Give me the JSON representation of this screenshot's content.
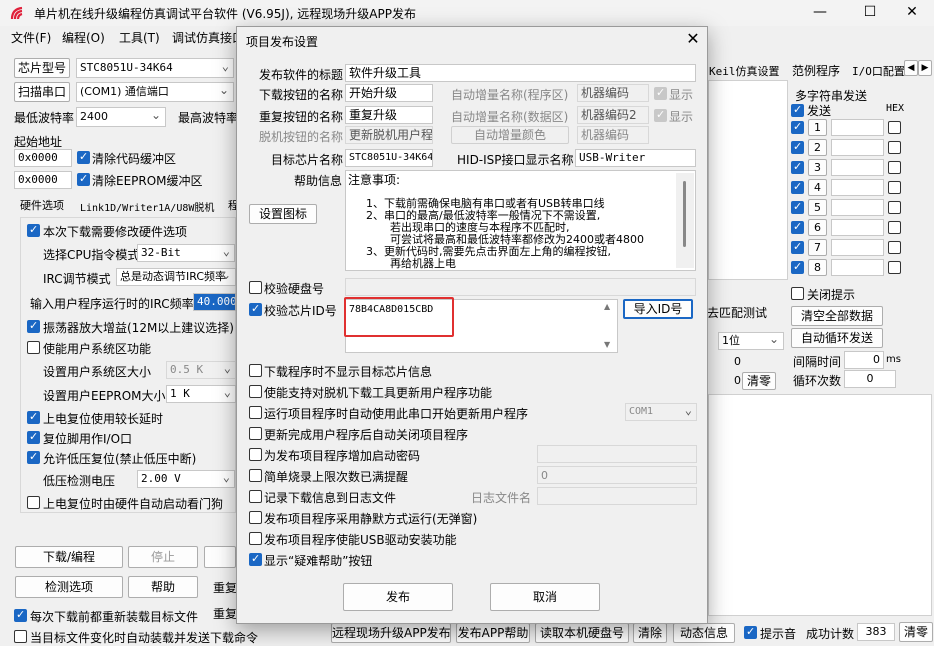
{
  "window": {
    "title": "单片机在线升级编程仿真调试平台软件 (V6.95J), 远程现场升级APP发布",
    "minimize": "—",
    "maximize": "☐",
    "close": "✕"
  },
  "menu": [
    "文件(F)",
    "编程(O)",
    "工具(T)",
    "调试仿真接口"
  ],
  "left": {
    "chip_type_label": "芯片型号",
    "chip_type_value": "STC8051U-34K64",
    "scan_port_button": "扫描串口",
    "port_value": "(COM1) 通信端口",
    "min_baud_label": "最低波特率",
    "min_baud_value": "2400",
    "max_baud_label": "最高波特率",
    "start_addr_label": "起始地址",
    "addr1": "0x0000",
    "clear_code_buffer": "清除代码缓冲区",
    "addr2": "0x0000",
    "clear_eeprom_buffer": "清除EEPROM缓冲区",
    "tabs": [
      "硬件选项",
      "Link1D/Writer1A/U8W脱机",
      "程"
    ],
    "options": {
      "modify_hw": "本次下载需要修改硬件选项",
      "cpu_mode_label": "选择CPU指令模式",
      "cpu_mode_value": "32-Bit",
      "irc_mode_label": "IRC调节模式",
      "irc_mode_value": "总是动态调节IRC频率",
      "irc_freq_label": "输入用户程序运行时的IRC频率",
      "irc_freq_value": "40.000",
      "osc_gain": "振荡器放大增益(12M以上建议选择)",
      "use_user_sys": "使能用户系统区功能",
      "user_sys_size_label": "设置用户系统区大小",
      "user_sys_size_value": "0.5 K",
      "eeprom_size_label": "设置用户EEPROM大小",
      "eeprom_size_value": "1   K",
      "power_reset_delay": "上电复位使用较长延时",
      "reset_pin_io": "复位脚用作I/O口",
      "low_volt_reset": "允许低压复位(禁止低压中断)",
      "low_volt_label": "低压检测电压",
      "low_volt_value": "2.00 V",
      "wdt_on_reset": "上电复位时由硬件自动启动看门狗"
    },
    "download_button": "下载/编程",
    "stop_button": "停止",
    "detect_button": "检测选项",
    "help_button": "帮助",
    "reload_each": "每次下载前都重新装载目标文件",
    "auto_load_on_change": "当目标文件变化时自动装载并发送下载命令",
    "repeat1": "重复",
    "repeat2": "重复"
  },
  "right": {
    "tabs": [
      "Keil仿真设置",
      "范例程序",
      "I/O口配置"
    ],
    "multi_send_title": "多字符串发送",
    "send_label": "发送",
    "hex_label": "HEX",
    "rows": [
      "1",
      "2",
      "3",
      "4",
      "5",
      "6",
      "7",
      "8"
    ],
    "close_hint": "关闭提示",
    "clear_all": "清空全部数据",
    "auto_loop": "自动循环发送",
    "interval_label": "间隔时间",
    "interval_value": "0",
    "interval_unit": "ms",
    "loop_count_label": "循环次数",
    "loop_count_value": "0",
    "match_test": "去匹配测试",
    "bits_value": "1位",
    "zero1": "0",
    "zero2": "0",
    "clear_zero": "清零"
  },
  "bottom": {
    "remote_publish": "远程现场升级APP发布",
    "publish_help": "发布APP帮助",
    "read_disk_id": "读取本机硬盘号",
    "clear": "清除",
    "dynamic_info": "动态信息",
    "beep": "提示音",
    "success_count_label": "成功计数",
    "success_count_value": "383",
    "reset_count": "清零"
  },
  "dialog": {
    "title": "项目发布设置",
    "close": "✕",
    "publish_title_label": "发布软件的标题",
    "publish_title_value": "软件升级工具",
    "download_btn_label": "下载按钮的名称",
    "download_btn_value": "开始升级",
    "auto_inc_prog_label": "自动增量名称(程序区)",
    "auto_inc_prog_value": "机器编码",
    "show1": "显示",
    "repeat_btn_label": "重复按钮的名称",
    "repeat_btn_value": "重复升级",
    "auto_inc_data_label": "自动增量名称(数据区)",
    "auto_inc_data_value": "机器编码2",
    "show2": "显示",
    "offline_btn_label": "脱机按钮的名称",
    "offline_btn_value": "更新脱机用户程",
    "auto_inc_color": "自动增量颜色",
    "machine_code_dis": "机器编码",
    "target_chip_label": "目标芯片名称",
    "target_chip_value": "STC8051U-34K64",
    "hid_label": "HID-ISP接口显示名称",
    "hid_value": "USB-Writer",
    "help_info_label": "帮助信息",
    "set_icon_button": "设置图标",
    "help_lines": [
      "注意事项:",
      "1、下载前需确保电脑有串口或者有USB转串口线",
      "2、串口的最高/最低波特率一般情况下不需设置,",
      "若出现串口的速度与本程序不匹配时,",
      "可尝试将最高和最低波特率都修改为2400或者4800",
      "3、更新代码时,需要先点击界面左上角的编程按钮,",
      "再给机器上电"
    ],
    "verify_disk": "校验硬盘号",
    "verify_chip_id": "校验芯片ID号",
    "chip_id_value": "78B4CA8D015CBD",
    "import_id_button": "导入ID号",
    "options": [
      {
        "label": "下载程序时不显示目标芯片信息",
        "checked": false
      },
      {
        "label": "使能支持对脱机下载工具更新用户程序功能",
        "checked": false
      },
      {
        "label": "运行项目程序时自动使用此串口开始更新用户程序",
        "checked": false
      },
      {
        "label": "更新完成用户程序后自动关闭项目程序",
        "checked": false
      },
      {
        "label": "为发布项目程序增加启动密码",
        "checked": false
      },
      {
        "label": "简单烧录上限次数已满提醒",
        "checked": false
      },
      {
        "label": "记录下载信息到日志文件",
        "checked": false
      },
      {
        "label": "发布项目程序采用静默方式运行(无弹窗)",
        "checked": false
      },
      {
        "label": "发布项目程序使能USB驱动安装功能",
        "checked": false
      },
      {
        "label": "显示“疑难帮助”按钮",
        "checked": true
      }
    ],
    "com_value": "COM1",
    "limit_value": "0",
    "log_file_label": "日志文件名",
    "publish_button": "发布",
    "cancel_button": "取消"
  }
}
